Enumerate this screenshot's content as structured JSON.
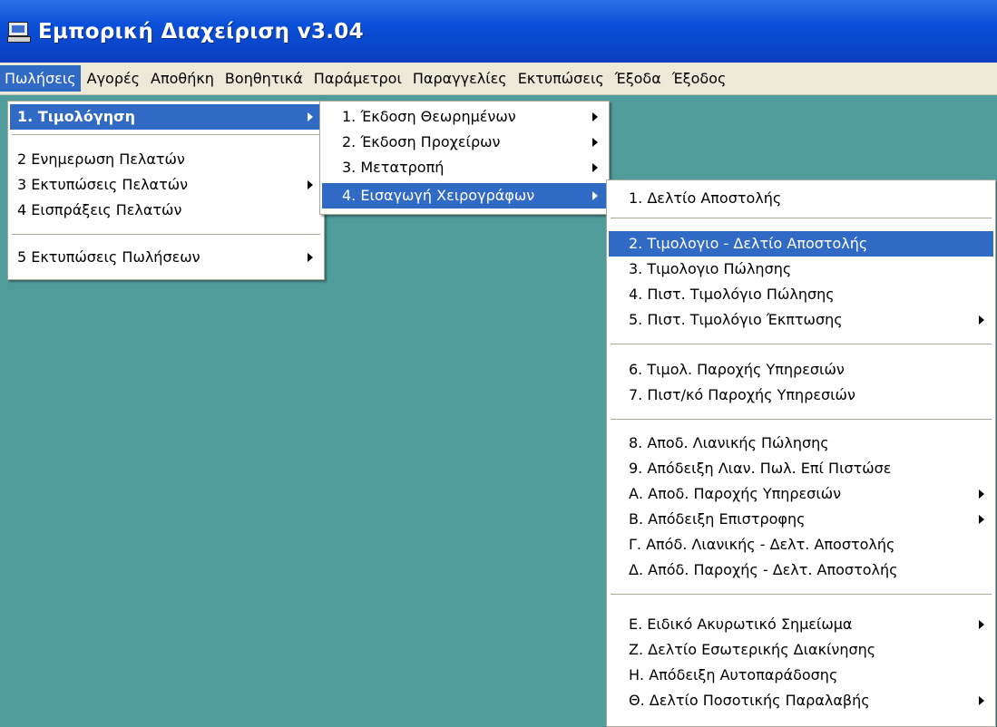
{
  "window": {
    "title": "Εμπορική Διαχείριση v3.04"
  },
  "menubar": {
    "items": [
      "Πωλήσεις",
      "Αγορές",
      "Αποθήκη",
      "Βοηθητικά",
      "Παράμετροι",
      "Παραγγελίες",
      "Εκτυπώσεις",
      "Έξοδα",
      "Έξοδος"
    ]
  },
  "menu_sales": {
    "items": [
      {
        "label": "1. Τιμολόγηση",
        "has_submenu": true,
        "highlighted": true
      },
      {
        "label": "2 Ενημερωση Πελατών",
        "has_submenu": false
      },
      {
        "label": "3 Εκτυπώσεις Πελατών",
        "has_submenu": true
      },
      {
        "label": "4 Εισπράξεις Πελατών",
        "has_submenu": false
      },
      {
        "label": "5 Εκτυπώσεις Πωλήσεων",
        "has_submenu": true
      }
    ]
  },
  "menu_invoicing": {
    "items": [
      {
        "label": "1. Έκδοση Θεωρημένων",
        "has_submenu": true
      },
      {
        "label": "2. Έκδοση Προχείρων",
        "has_submenu": true
      },
      {
        "label": "3. Μετατροπή",
        "has_submenu": true
      },
      {
        "label": "4. Εισαγωγή Χειρογράφων",
        "has_submenu": true,
        "highlighted": true
      }
    ]
  },
  "menu_manual": {
    "items": [
      {
        "label": "1. Δελτίο Αποστολής",
        "has_submenu": false
      },
      {
        "label": "2. Τιμολογιο - Δελτίο Αποστολής",
        "has_submenu": false,
        "highlighted": true
      },
      {
        "label": "3. Τιμολογιο Πώλησης",
        "has_submenu": false
      },
      {
        "label": "4. Πιστ. Τιμολόγιο Πώλησης",
        "has_submenu": false
      },
      {
        "label": "5. Πιστ. Τιμολόγιο Έκπτωσης",
        "has_submenu": true
      },
      {
        "label": "6. Τιμολ. Παροχής Υπηρεσιών",
        "has_submenu": false
      },
      {
        "label": "7. Πιστ/κό Παροχής Υπηρεσιών",
        "has_submenu": false
      },
      {
        "label": "8. Αποδ. Λιανικής Πώλησης",
        "has_submenu": false
      },
      {
        "label": "9. Απόδειξη Λιαν. Πωλ. Επί Πιστώσε",
        "has_submenu": false
      },
      {
        "label": "Α. Αποδ. Παροχής Υπηρεσιών",
        "has_submenu": true
      },
      {
        "label": "Β. Απόδειξη Επιστροφης",
        "has_submenu": true
      },
      {
        "label": "Γ. Απόδ. Λιανικής - Δελτ. Αποστολής",
        "has_submenu": false
      },
      {
        "label": "Δ. Απόδ. Παροχής - Δελτ. Αποστολής",
        "has_submenu": false
      },
      {
        "label": "Ε. Ειδικό Ακυρωτικό Σημείωμα",
        "has_submenu": true
      },
      {
        "label": "Ζ. Δελτίο Εσωτερικής Διακίνησης",
        "has_submenu": false
      },
      {
        "label": "Η. Απόδειξη Αυτοπαράδοσης",
        "has_submenu": false
      },
      {
        "label": "Θ. Δελτίο Ποσοτικής Παραλαβής",
        "has_submenu": true
      }
    ]
  }
}
